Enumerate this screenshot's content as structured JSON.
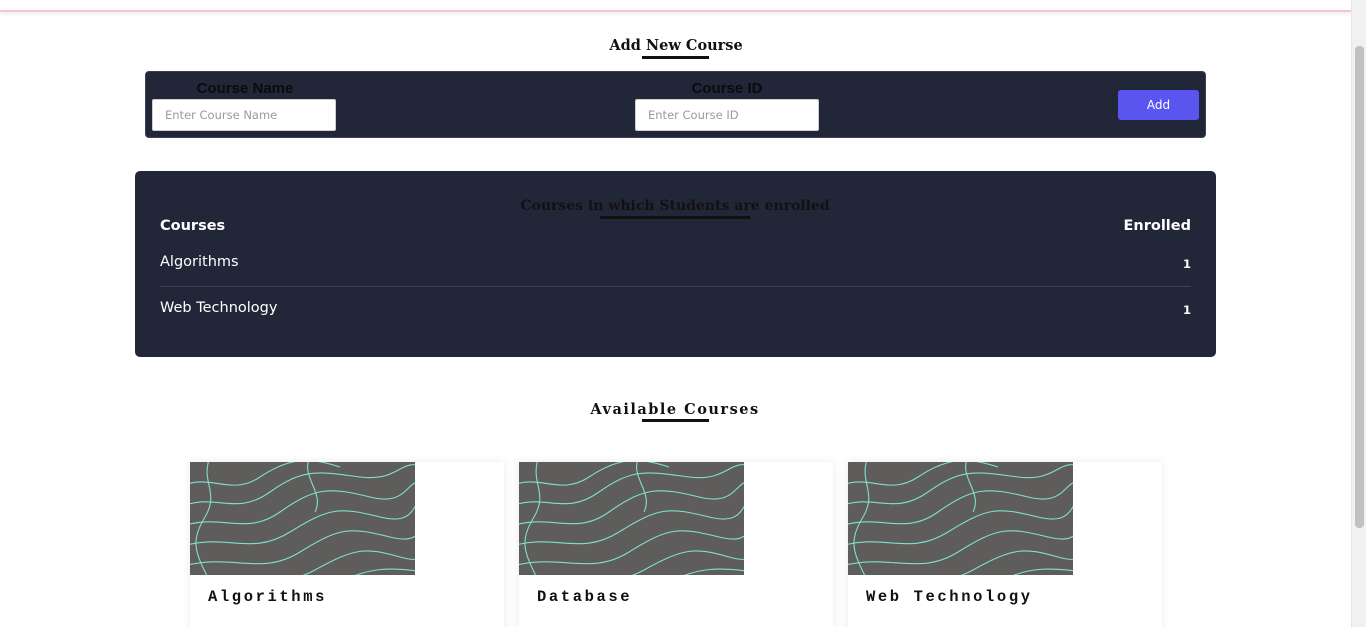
{
  "add_course": {
    "title": "Add New Course",
    "name_label": "Course Name",
    "name_placeholder": "Enter Course Name",
    "name_value": "",
    "id_label": "Course ID",
    "id_placeholder": "Enter Course ID",
    "id_value": "",
    "add_label": "Add"
  },
  "enrolled": {
    "title": "Courses in which Students are enrolled",
    "col_courses": "Courses",
    "col_enrolled": "Enrolled",
    "rows": [
      {
        "course": "Algorithms",
        "count": "1"
      },
      {
        "course": "Web Technology",
        "count": "1"
      }
    ]
  },
  "available": {
    "title": "Available Courses",
    "cards": [
      {
        "title": "Algorithms"
      },
      {
        "title": "Database"
      },
      {
        "title": "Web Technology"
      }
    ]
  },
  "colors": {
    "panel_bg": "#212638",
    "accent": "#5b55f0",
    "card_image_bg": "#5f5c5c",
    "contour_line": "#7fe0cf"
  }
}
